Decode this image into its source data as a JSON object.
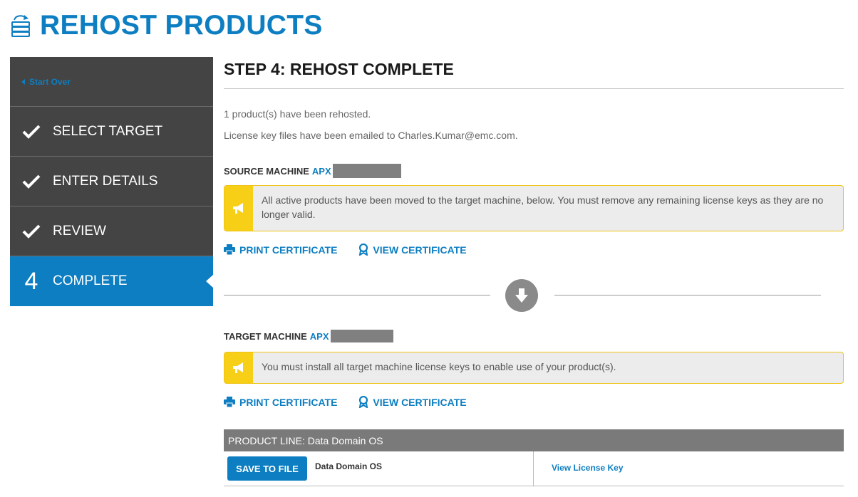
{
  "header": {
    "title": "REHOST PRODUCTS",
    "icon": "rehost-icon"
  },
  "sidebar": {
    "start_over": "Start Over",
    "steps": [
      {
        "label": "SELECT TARGET",
        "state": "done"
      },
      {
        "label": "ENTER DETAILS",
        "state": "done"
      },
      {
        "label": "REVIEW",
        "state": "done"
      },
      {
        "label": "COMPLETE",
        "state": "active",
        "number": "4"
      }
    ]
  },
  "main": {
    "step_title": "STEP 4: REHOST COMPLETE",
    "rehosted_msg": "1 product(s) have been rehosted.",
    "email_msg": "License key files have been emailed to Charles.Kumar@emc.com.",
    "source": {
      "label": "SOURCE MACHINE",
      "id_prefix": "APX",
      "alert": "All active products have been moved to the target machine, below. You must remove any remaining license keys as they are no longer valid.",
      "print": "PRINT CERTIFICATE",
      "view": "VIEW CERTIFICATE"
    },
    "target": {
      "label": "TARGET MACHINE",
      "id_prefix": "APX",
      "alert": "You must install all target machine license keys to enable use of your product(s).",
      "print": "PRINT CERTIFICATE",
      "view": "VIEW CERTIFICATE"
    },
    "product": {
      "line_header": "PRODUCT LINE: Data Domain OS",
      "save_label": "SAVE TO FILE",
      "name": "Data Domain OS",
      "view_key": "View License Key"
    }
  },
  "colors": {
    "accent": "#0d7ec1",
    "sidebar_bg": "#444444",
    "alert_icon_bg": "#f7cf16",
    "alert_bg": "#ececec"
  }
}
